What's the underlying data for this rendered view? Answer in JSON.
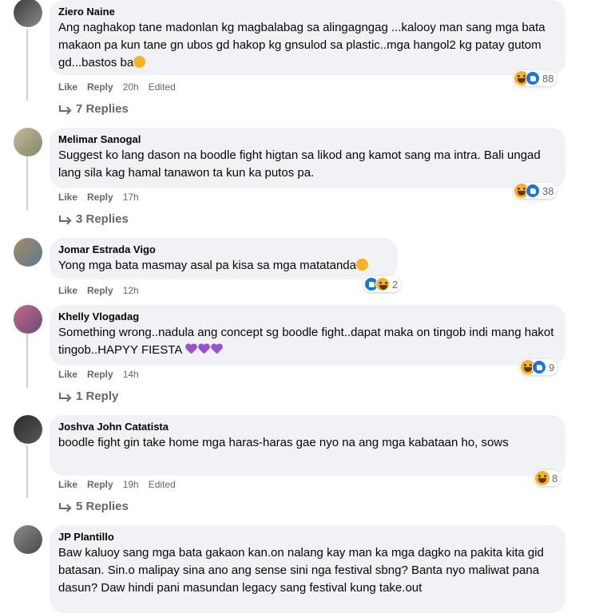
{
  "comments": [
    {
      "author": "Ziero Naine",
      "text": "Ang naghakop tane madonlan kg magbalabag sa alingagngag ...kalooy man sang mga bata makaon pa kun tane gn ubos gd hakop kg gnsulod sa plastic..mga hangol2 kg patay gutom gd...bastos ba",
      "like": "Like",
      "reply": "Reply",
      "time": "20h",
      "edited": "Edited",
      "reaction_count": "88",
      "replies": "7 Replies"
    },
    {
      "author": "Melimar Sanogal",
      "text": "Suggest ko lang dason na boodle fight higtan sa likod ang kamot sang ma intra. Bali ungad lang sila kag hamal tanawon ta kun ka putos pa.",
      "like": "Like",
      "reply": "Reply",
      "time": "17h",
      "reaction_count": "38",
      "replies": "3 Replies"
    },
    {
      "author": "Jomar Estrada Vigo",
      "text": "Yong mga bata masmay asal pa kisa sa mga matatanda",
      "like": "Like",
      "reply": "Reply",
      "time": "12h",
      "reaction_count": "2"
    },
    {
      "author": "Khelly Vlogadag",
      "text": "Something wrong..nadula ang concept sg boodle fight..dapat maka on tingob indi mang hakot tingob..HAPYY FIESTA",
      "like": "Like",
      "reply": "Reply",
      "time": "14h",
      "reaction_count": "9",
      "replies": "1 Reply"
    },
    {
      "author": "Joshva John Catatista",
      "text": "boodle fight gin take home mga haras-haras gae nyo na ang mga kabataan ho, sows",
      "like": "Like",
      "reply": "Reply",
      "time": "19h",
      "edited": "Edited",
      "reaction_count": "8",
      "replies": "5 Replies"
    },
    {
      "author": "JP Plantillo",
      "text": "Baw kaluoy sang mga bata gakaon kan.on nalang kay man ka mga dagko na pakita kita gid batasan. Sin.o malipay sina ano ang sense sini nga festival sbng? Banta nyo maliwat pana dasun? Daw hindi pani masundan legacy sang festival kung take.out"
    }
  ],
  "colors": {
    "bubble": "#f0f2f5",
    "meta": "#65676b",
    "like_blue": "#1b74e4",
    "haha_yellow": "#f7b125",
    "heart_purple": "#9b4fd9"
  }
}
